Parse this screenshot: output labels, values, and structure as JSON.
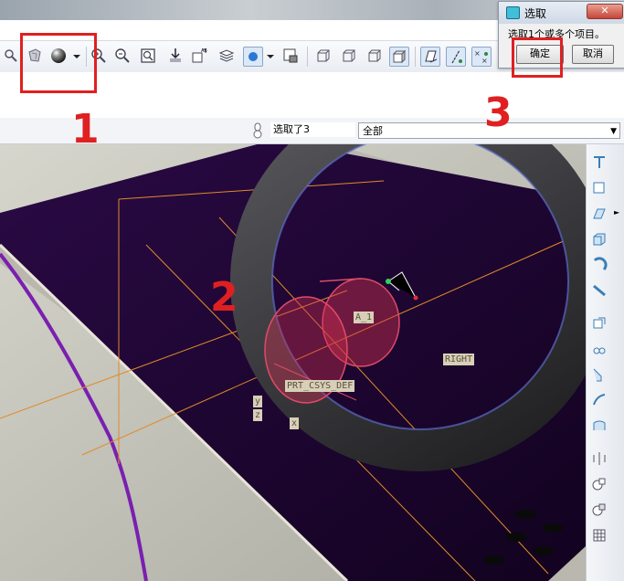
{
  "dialog": {
    "title": "选取",
    "close_glyph": "✕",
    "message": "选取1个或多个项目。",
    "ok_label": "确定",
    "cancel_label": "取消"
  },
  "filter": {
    "selected_label": "选取了3",
    "combo_value": "全部"
  },
  "datums": {
    "axis": "A_1",
    "csys": "PRT_CSYS_DEF",
    "plane": "RIGHT",
    "y": "y",
    "z": "z",
    "x": "x"
  },
  "annotations": {
    "one": "1",
    "two": "2",
    "three": "3"
  },
  "toolbar": {
    "icons": [
      "refit-icon",
      "appearance-icon",
      "appearance-dropdown",
      "zoom-in-icon",
      "zoom-out-icon",
      "refit-view-icon",
      "repaint-icon",
      "orient-icon",
      "layers-icon",
      "view-manager-icon",
      "saved-views-icon",
      "datum-display-icon",
      "hidden-line-icon",
      "no-hidden-icon",
      "shading-icon",
      "shaded-icon",
      "plane-display-icon",
      "axis-display-icon",
      "point-display-icon"
    ]
  },
  "colors": {
    "annotation_red": "#e02020",
    "model_purple": "#1e0632",
    "selection_red": "#d03050"
  }
}
